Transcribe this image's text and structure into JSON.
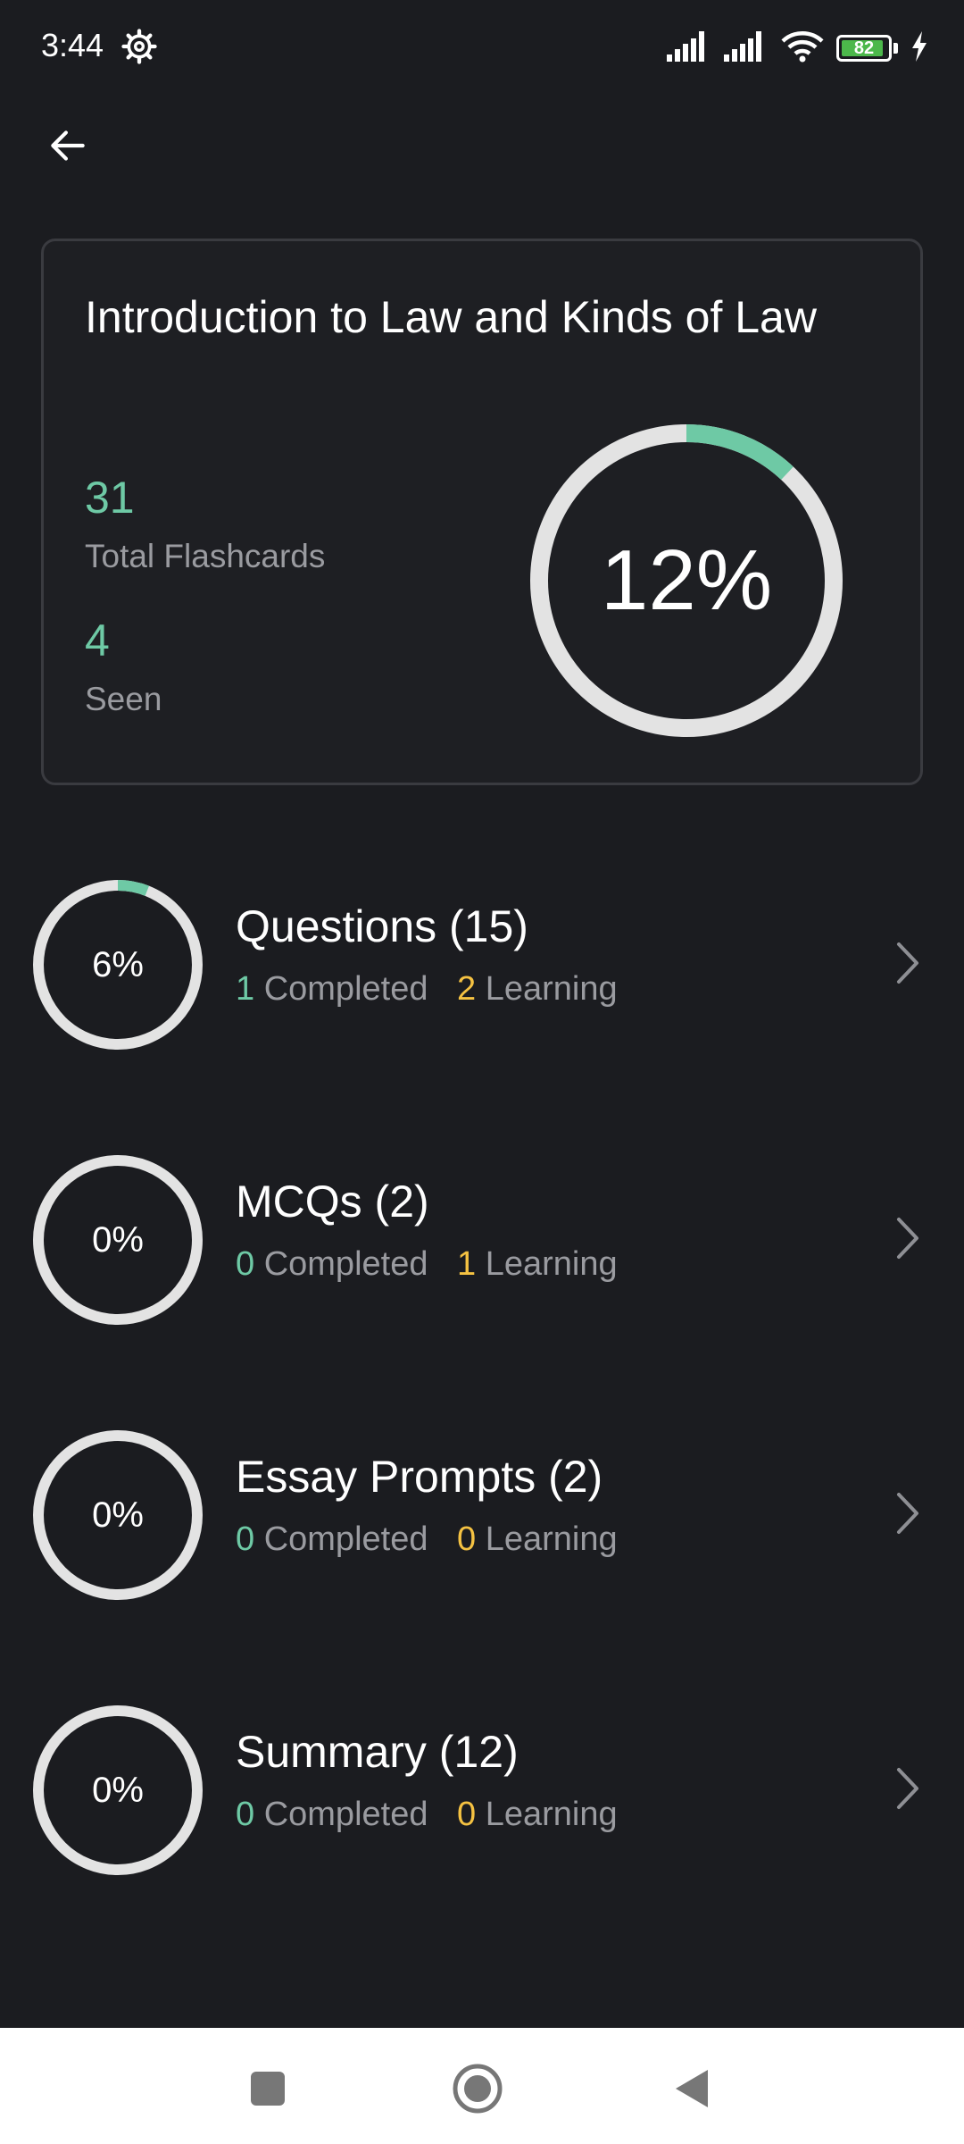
{
  "status_bar": {
    "time": "3:44",
    "battery_level": "82",
    "icons": [
      "settings-gear-icon",
      "signal-icon",
      "signal-icon",
      "wifi-icon",
      "battery-icon",
      "charging-bolt-icon"
    ]
  },
  "header": {
    "back_icon": "arrow-left-icon"
  },
  "summary": {
    "title": "Introduction to Law and Kinds of Law",
    "total_flashcards_value": "31",
    "total_flashcards_label": "Total Flashcards",
    "seen_value": "4",
    "seen_label": "Seen",
    "progress_label": "12%",
    "progress_fraction": 0.12
  },
  "sections": [
    {
      "title": "Questions (15)",
      "progress_label": "6%",
      "progress_fraction": 0.06,
      "completed_count": "1",
      "completed_label": "Completed",
      "learning_count": "2",
      "learning_label": "Learning"
    },
    {
      "title": "MCQs (2)",
      "progress_label": "0%",
      "progress_fraction": 0,
      "completed_count": "0",
      "completed_label": "Completed",
      "learning_count": "1",
      "learning_label": "Learning"
    },
    {
      "title": "Essay Prompts (2)",
      "progress_label": "0%",
      "progress_fraction": 0,
      "completed_count": "0",
      "completed_label": "Completed",
      "learning_count": "0",
      "learning_label": "Learning"
    },
    {
      "title": "Summary (12)",
      "progress_label": "0%",
      "progress_fraction": 0,
      "completed_count": "0",
      "completed_label": "Completed",
      "learning_count": "0",
      "learning_label": "Learning"
    }
  ],
  "colors": {
    "background": "#1b1c20",
    "accent_green": "#6ec9a5",
    "accent_yellow": "#f5c242",
    "ring_track": "#e3e3e3"
  },
  "nav_bar": {
    "icons": [
      "recents-square-icon",
      "home-circle-icon",
      "back-triangle-icon"
    ]
  }
}
